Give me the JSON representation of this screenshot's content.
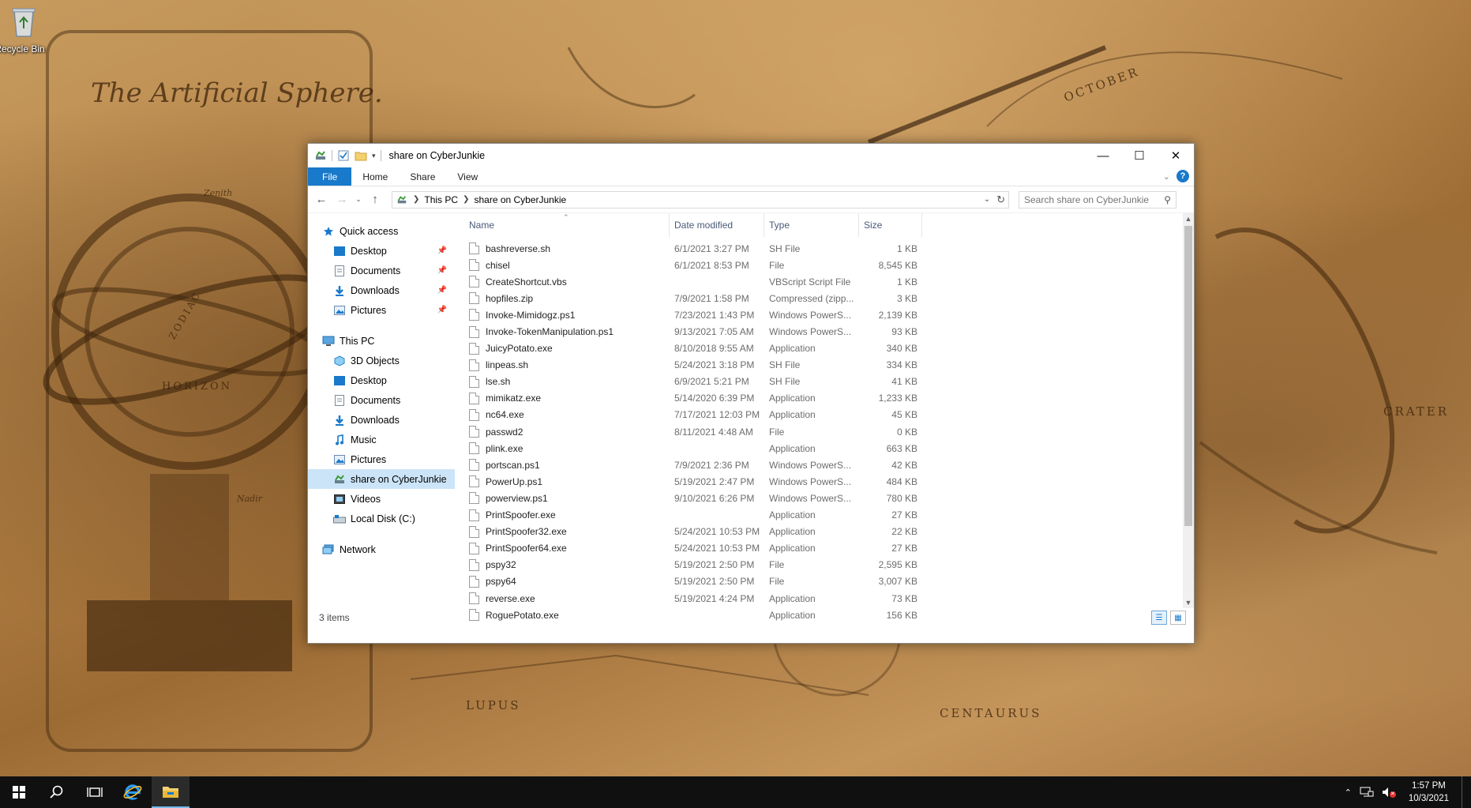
{
  "desktop": {
    "recycle_bin_label": "Recycle Bin",
    "wallpaper_texts": {
      "title": "The Artificial Sphere.",
      "october": "OCTOBER",
      "crater": "CRATER",
      "lupus": "LUPUS",
      "centaurus": "CENTAURUS",
      "horizon": "HORIZON",
      "zodiac": "ZODIAC",
      "zenith": "Zenith",
      "nadir": "Nadir"
    }
  },
  "window": {
    "title": "share on CyberJunkie",
    "ribbon_tabs": [
      "File",
      "Home",
      "Share",
      "View"
    ],
    "address": {
      "crumbs": [
        "This PC",
        "share on CyberJunkie"
      ]
    },
    "search": {
      "placeholder": "Search share on CyberJunkie"
    },
    "nav": {
      "quick_access": {
        "label": "Quick access",
        "items": [
          "Desktop",
          "Documents",
          "Downloads",
          "Pictures"
        ]
      },
      "this_pc": {
        "label": "This PC",
        "items": [
          "3D Objects",
          "Desktop",
          "Documents",
          "Downloads",
          "Music",
          "Pictures",
          "share on CyberJunkie",
          "Videos",
          "Local Disk (C:)"
        ]
      },
      "network": {
        "label": "Network"
      }
    },
    "columns": {
      "name": "Name",
      "date": "Date modified",
      "type": "Type",
      "size": "Size"
    },
    "files": [
      {
        "name": "bashreverse.sh",
        "date": "6/1/2021 3:27 PM",
        "type": "SH File",
        "size": "1 KB"
      },
      {
        "name": "chisel",
        "date": "6/1/2021 8:53 PM",
        "type": "File",
        "size": "8,545 KB"
      },
      {
        "name": "CreateShortcut.vbs",
        "date": "",
        "type": "VBScript Script File",
        "size": "1 KB"
      },
      {
        "name": "hopfiles.zip",
        "date": "7/9/2021 1:58 PM",
        "type": "Compressed (zipp...",
        "size": "3 KB"
      },
      {
        "name": "Invoke-Mimidogz.ps1",
        "date": "7/23/2021 1:43 PM",
        "type": "Windows PowerS...",
        "size": "2,139 KB"
      },
      {
        "name": "Invoke-TokenManipulation.ps1",
        "date": "9/13/2021 7:05 AM",
        "type": "Windows PowerS...",
        "size": "93 KB"
      },
      {
        "name": "JuicyPotato.exe",
        "date": "8/10/2018 9:55 AM",
        "type": "Application",
        "size": "340 KB"
      },
      {
        "name": "linpeas.sh",
        "date": "5/24/2021 3:18 PM",
        "type": "SH File",
        "size": "334 KB"
      },
      {
        "name": "lse.sh",
        "date": "6/9/2021 5:21 PM",
        "type": "SH File",
        "size": "41 KB"
      },
      {
        "name": "mimikatz.exe",
        "date": "5/14/2020 6:39 PM",
        "type": "Application",
        "size": "1,233 KB"
      },
      {
        "name": "nc64.exe",
        "date": "7/17/2021 12:03 PM",
        "type": "Application",
        "size": "45 KB"
      },
      {
        "name": "passwd2",
        "date": "8/11/2021 4:48 AM",
        "type": "File",
        "size": "0 KB"
      },
      {
        "name": "plink.exe",
        "date": "",
        "type": "Application",
        "size": "663 KB"
      },
      {
        "name": "portscan.ps1",
        "date": "7/9/2021 2:36 PM",
        "type": "Windows PowerS...",
        "size": "42 KB"
      },
      {
        "name": "PowerUp.ps1",
        "date": "5/19/2021 2:47 PM",
        "type": "Windows PowerS...",
        "size": "484 KB"
      },
      {
        "name": "powerview.ps1",
        "date": "9/10/2021 6:26 PM",
        "type": "Windows PowerS...",
        "size": "780 KB"
      },
      {
        "name": "PrintSpoofer.exe",
        "date": "",
        "type": "Application",
        "size": "27 KB"
      },
      {
        "name": "PrintSpoofer32.exe",
        "date": "5/24/2021 10:53 PM",
        "type": "Application",
        "size": "22 KB"
      },
      {
        "name": "PrintSpoofer64.exe",
        "date": "5/24/2021 10:53 PM",
        "type": "Application",
        "size": "27 KB"
      },
      {
        "name": "pspy32",
        "date": "5/19/2021 2:50 PM",
        "type": "File",
        "size": "2,595 KB"
      },
      {
        "name": "pspy64",
        "date": "5/19/2021 2:50 PM",
        "type": "File",
        "size": "3,007 KB"
      },
      {
        "name": "reverse.exe",
        "date": "5/19/2021 4:24 PM",
        "type": "Application",
        "size": "73 KB"
      },
      {
        "name": "RoguePotato.exe",
        "date": "",
        "type": "Application",
        "size": "156 KB"
      }
    ],
    "status": {
      "item_count": "3 items"
    }
  },
  "taskbar": {
    "clock_time": "1:57 PM",
    "clock_date": "10/3/2021"
  },
  "colors": {
    "accent": "#1979ca",
    "selection": "#cce4f7",
    "taskbar": "#101010"
  }
}
